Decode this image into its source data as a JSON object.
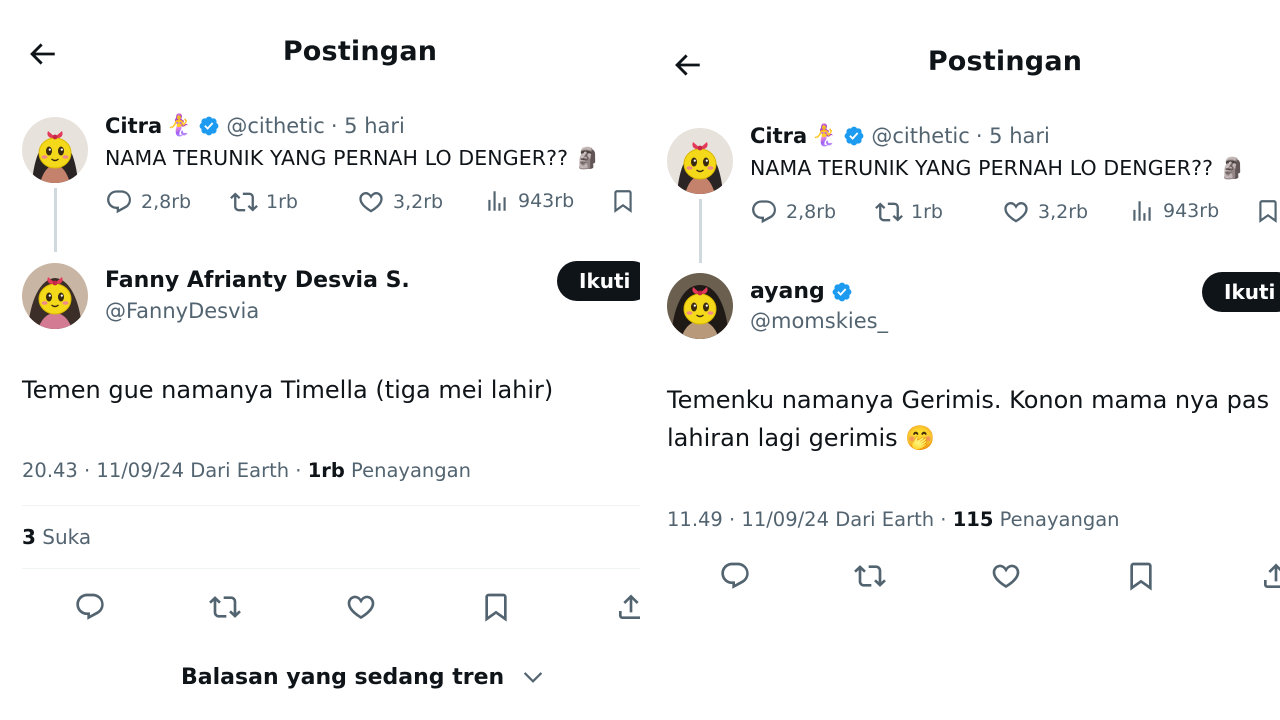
{
  "left": {
    "header": {
      "title": "Postingan"
    },
    "quoted": {
      "author": "Citra",
      "emoji": "🧜‍♀️",
      "handle": "@cithetic",
      "time": "· 5 hari",
      "text": "NAMA TERUNIK YANG PERNAH LO DENGER?? 🗿",
      "stats": {
        "replies": "2,8rb",
        "reposts": "1rb",
        "likes": "3,2rb",
        "views": "943rb"
      }
    },
    "reply": {
      "name": "Fanny Afrianty Desvia S.",
      "handle": "@FannyDesvia",
      "follow_label": "Ikuti",
      "text": "Temen gue namanya Timella (tiga mei lahir)",
      "meta_prefix": "20.43 · 11/09/24 Dari Earth · ",
      "meta_views": "1rb",
      "meta_views_label": " Penayangan",
      "likes_count": "3",
      "likes_label": " Suka"
    },
    "trending_label": "Balasan yang sedang tren"
  },
  "right": {
    "header": {
      "title": "Postingan"
    },
    "quoted": {
      "author": "Citra",
      "emoji": "🧜‍♀️",
      "handle": "@cithetic",
      "time": "· 5 hari",
      "text": "NAMA TERUNIK YANG PERNAH LO DENGER?? 🗿",
      "stats": {
        "replies": "2,8rb",
        "reposts": "1rb",
        "likes": "3,2rb",
        "views": "943rb"
      }
    },
    "reply": {
      "name": "ayang",
      "handle": "@momskies_",
      "follow_label": "Ikuti",
      "text_line1": "Temenku namanya Gerimis. Konon mama nya pas",
      "text_line2": "lahiran lagi gerimis 🤭",
      "meta_prefix": "11.49 · 11/09/24 Dari Earth · ",
      "meta_views": "115",
      "meta_views_label": " Penayangan"
    }
  },
  "colors": {
    "text": "#0f1419",
    "muted": "#536471",
    "verified": "#1d9bf0",
    "follow_bg": "#0f1419",
    "divider": "#eff3f4"
  },
  "icons": [
    "back-arrow-icon",
    "verified-icon",
    "reply-icon",
    "repost-icon",
    "like-icon",
    "views-icon",
    "bookmark-icon",
    "share-icon",
    "chevron-down-icon"
  ]
}
